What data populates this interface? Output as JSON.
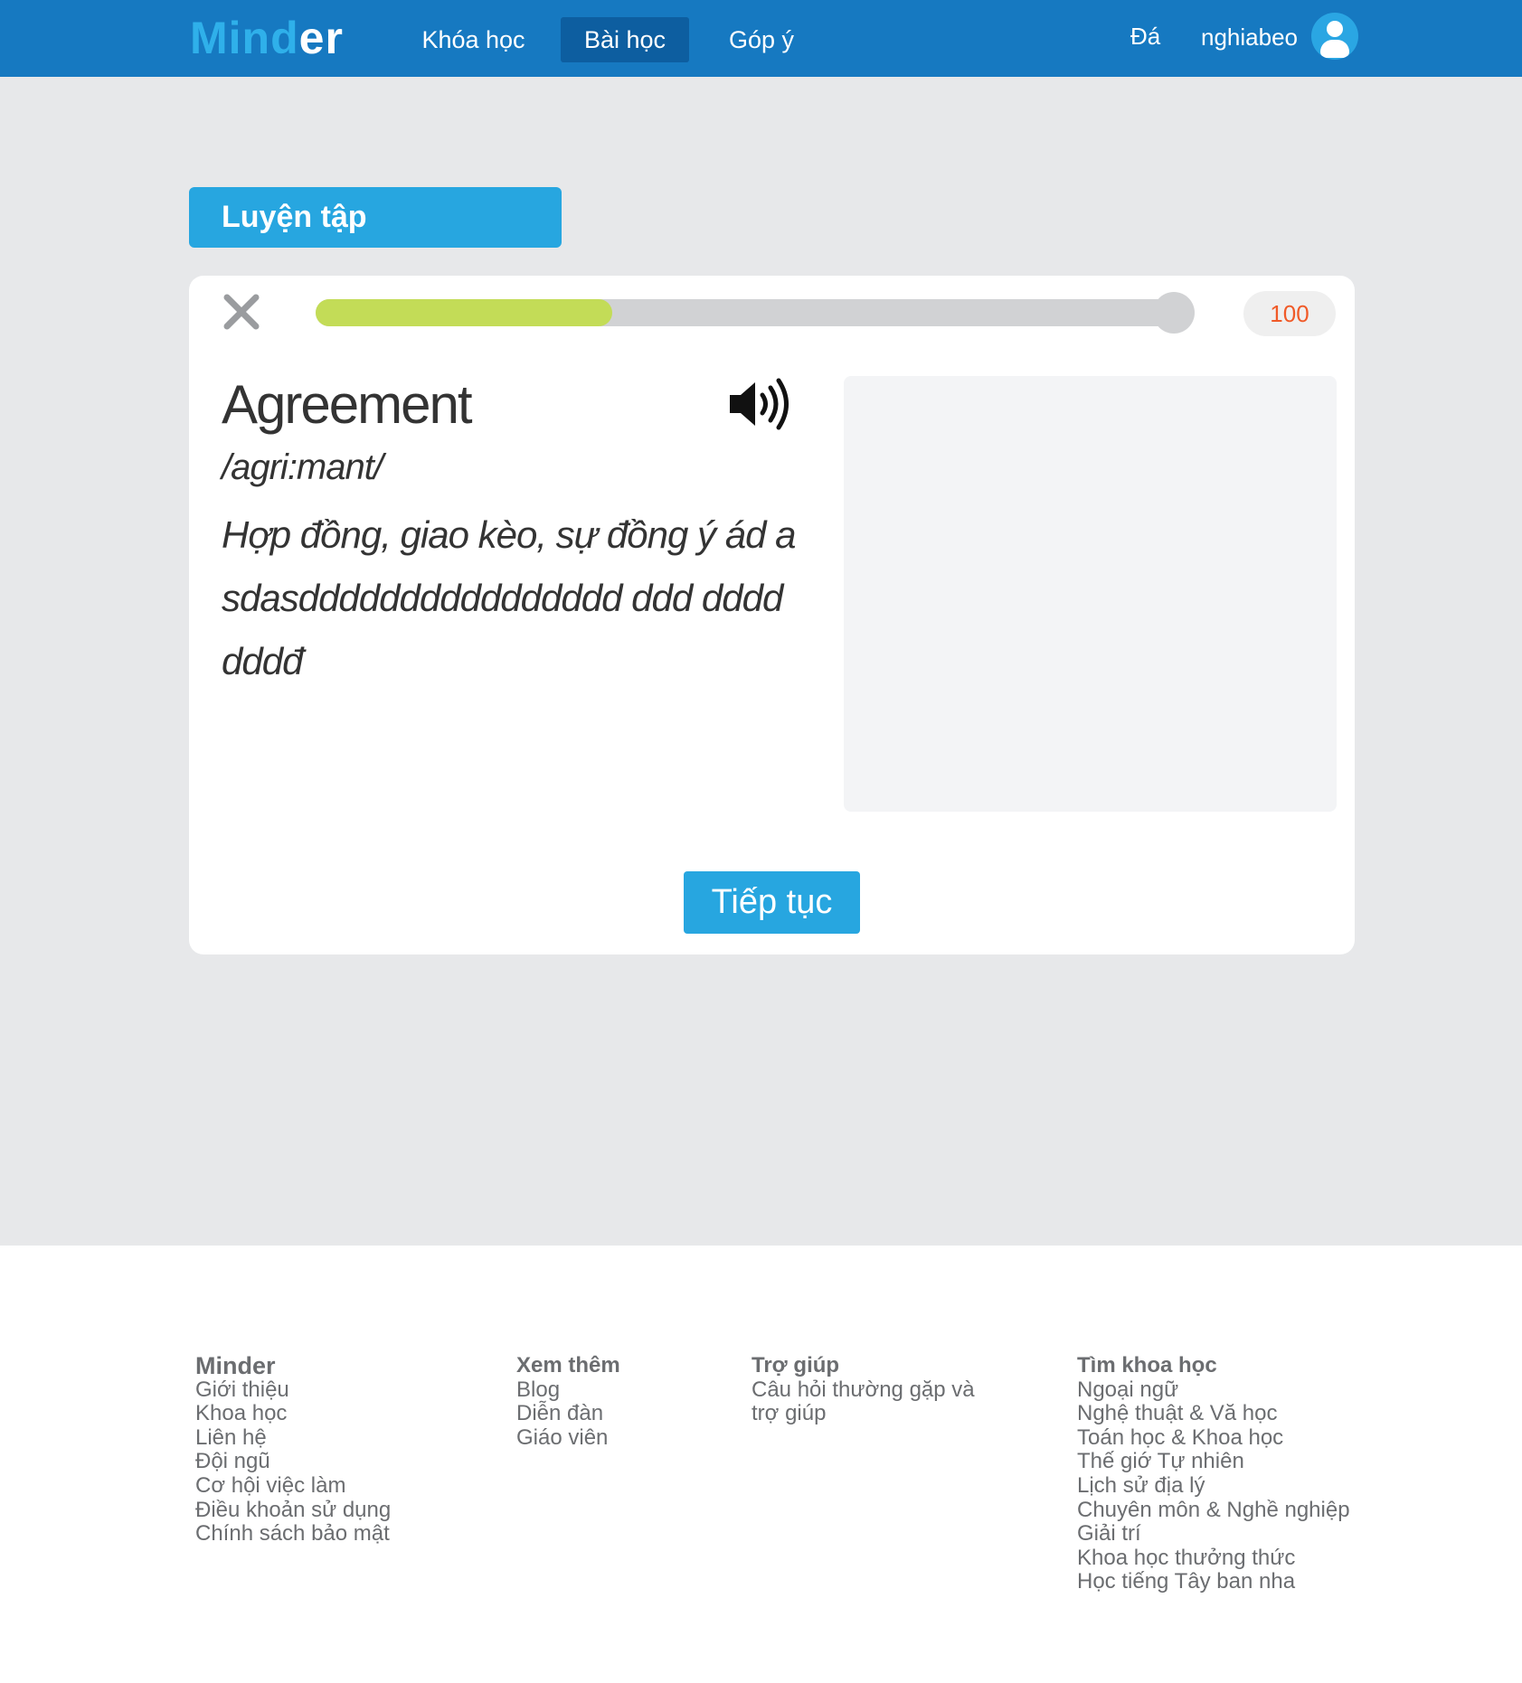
{
  "header": {
    "logo_part1": "Mind",
    "logo_part2": "er",
    "nav": [
      {
        "label": "Khóa học",
        "active": false
      },
      {
        "label": "Bài học",
        "active": true
      },
      {
        "label": "Góp ý",
        "active": false
      }
    ],
    "language": "Đá",
    "username": "nghiabeo"
  },
  "practice_tab": {
    "label": "Luyện tập"
  },
  "card": {
    "progress_percent": 34,
    "score": "100",
    "word": "Agreement",
    "phonetic": "/agri:mant/",
    "meaning": "Hợp đồng, giao kèo, sự đồng ý ád asdasdddddddddddddddd ddd dddddddđ",
    "continue_label": "Tiếp tục"
  },
  "footer": {
    "col1": {
      "title": "Minder",
      "links": [
        "Giới thiệu",
        "Khoa học",
        "Liên hệ",
        "Đội ngũ",
        "Cơ hội việc làm",
        "Điều khoản sử dụng",
        "Chính sách bảo mật"
      ]
    },
    "col2": {
      "title": "Xem thêm",
      "links": [
        "Blog",
        "Diễn đàn",
        "Giáo viên"
      ]
    },
    "col3": {
      "title": "Trợ giúp",
      "links": [
        "Câu hỏi thường gặp và",
        "trợ giúp"
      ]
    },
    "col4": {
      "title": "Tìm khoa học",
      "links": [
        "Ngoại ngữ",
        "Nghệ thuật & Vă học",
        "Toán học & Khoa học",
        "Thế giớ Tự nhiên",
        "Lịch sử địa lý",
        "Chuyên môn & Nghề nghiệp",
        "Giải trí",
        "Khoa học thưởng thức",
        "Học tiếng Tây ban nha"
      ]
    }
  },
  "colors": {
    "header_bg": "#1679c1",
    "accent": "#27a6e0",
    "progress_fill": "#c3dc57",
    "score_text": "#f05a28"
  },
  "icons": {
    "close": "close-icon",
    "speaker": "speaker-icon",
    "avatar": "user-avatar-icon"
  }
}
